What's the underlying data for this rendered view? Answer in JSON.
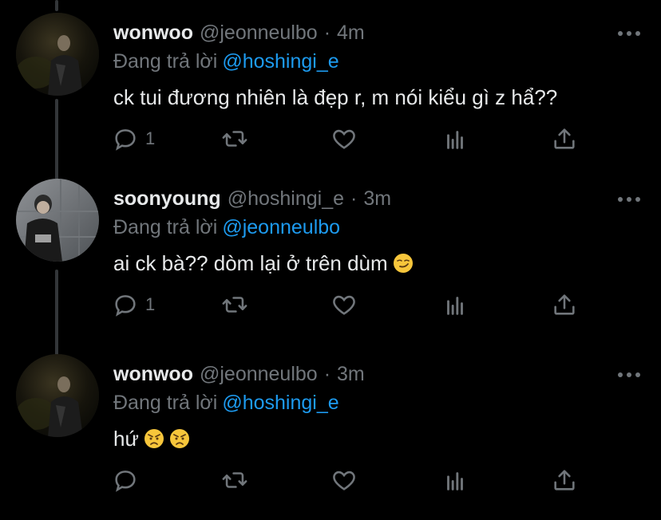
{
  "colors": {
    "background": "#000000",
    "text": "#e7e9ea",
    "muted": "#71767b",
    "link": "#1d9bf0",
    "thread_line": "#333639"
  },
  "tweets": [
    {
      "name": "wonwoo",
      "handle": "@jeonneulbo",
      "dot": "·",
      "time": "4m",
      "reply_prefix": "Đang trả lời",
      "reply_to": "@hoshingi_e",
      "text": "ck tui đương nhiên là đẹp r, m nói kiểu gì z hẩ??",
      "emoji": [],
      "reply_count": "1",
      "avatar": "dark-night-photo-avatar"
    },
    {
      "name": "soonyoung",
      "handle": "@hoshingi_e",
      "dot": "·",
      "time": "3m",
      "reply_prefix": "Đang trả lời",
      "reply_to": "@jeonneulbo",
      "text": "ai ck bà?? dòm lại ở trên dùm",
      "emoji": [
        "smirking-face"
      ],
      "reply_count": "1",
      "avatar": "grey-wall-photo-avatar"
    },
    {
      "name": "wonwoo",
      "handle": "@jeonneulbo",
      "dot": "·",
      "time": "3m",
      "reply_prefix": "Đang trả lời",
      "reply_to": "@hoshingi_e",
      "text": "hứ",
      "emoji": [
        "angry-face",
        "angry-face"
      ],
      "reply_count": "",
      "avatar": "dark-night-photo-avatar"
    }
  ],
  "action_icons": [
    "reply-icon",
    "retweet-icon",
    "like-icon",
    "analytics-icon",
    "share-icon"
  ]
}
